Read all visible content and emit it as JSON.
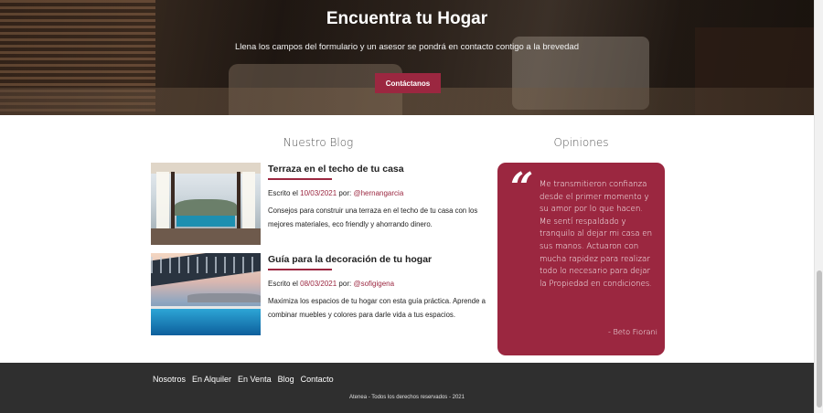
{
  "hero": {
    "title": "Encuentra tu Hogar",
    "subtitle": "Llena los campos del formulario y un asesor se pondrá en contacto contigo a la brevedad",
    "button_label": "Contáctanos"
  },
  "blog": {
    "heading": "Nuestro Blog",
    "posts": [
      {
        "title": "Terraza en el techo de tu casa",
        "written_label": "Escrito el",
        "date": "10/03/2021",
        "by_label": "por:",
        "author": "@hernangarcia",
        "excerpt": "Consejos para construir una terraza en el techo de tu casa con los mejores materiales, eco friendly y ahorrando dinero."
      },
      {
        "title": "Guía para la decoración de tu hogar",
        "written_label": "Escrito el",
        "date": "08/03/2021",
        "by_label": "por:",
        "author": "@sofigigena",
        "excerpt": "Maximiza los espacios de tu hogar con esta guía práctica. Aprende a combinar muebles y colores para darle vida a tus espacios."
      }
    ]
  },
  "opinions": {
    "heading": "Opiniones",
    "quote_mark": "“",
    "text": "Me transmitieron confianza desde el primer momento y su amor por lo que hacen. Me sentí respaldado y tranquilo al dejar mi casa en sus manos. Actuaron con mucha rapidez para realizar todo lo necesario para dejar la Propiedad en condiciones.",
    "author": "- Beto Fiorani"
  },
  "footer": {
    "nav": [
      "Nosotros",
      "En Alquiler",
      "En Venta",
      "Blog",
      "Contacto"
    ],
    "copyright": "Atenea - Todos los derechos reservados - 2021"
  },
  "colors": {
    "accent": "#9b2740",
    "footer_bg": "#2f2f2f"
  },
  "icons": [
    "quote-icon"
  ]
}
